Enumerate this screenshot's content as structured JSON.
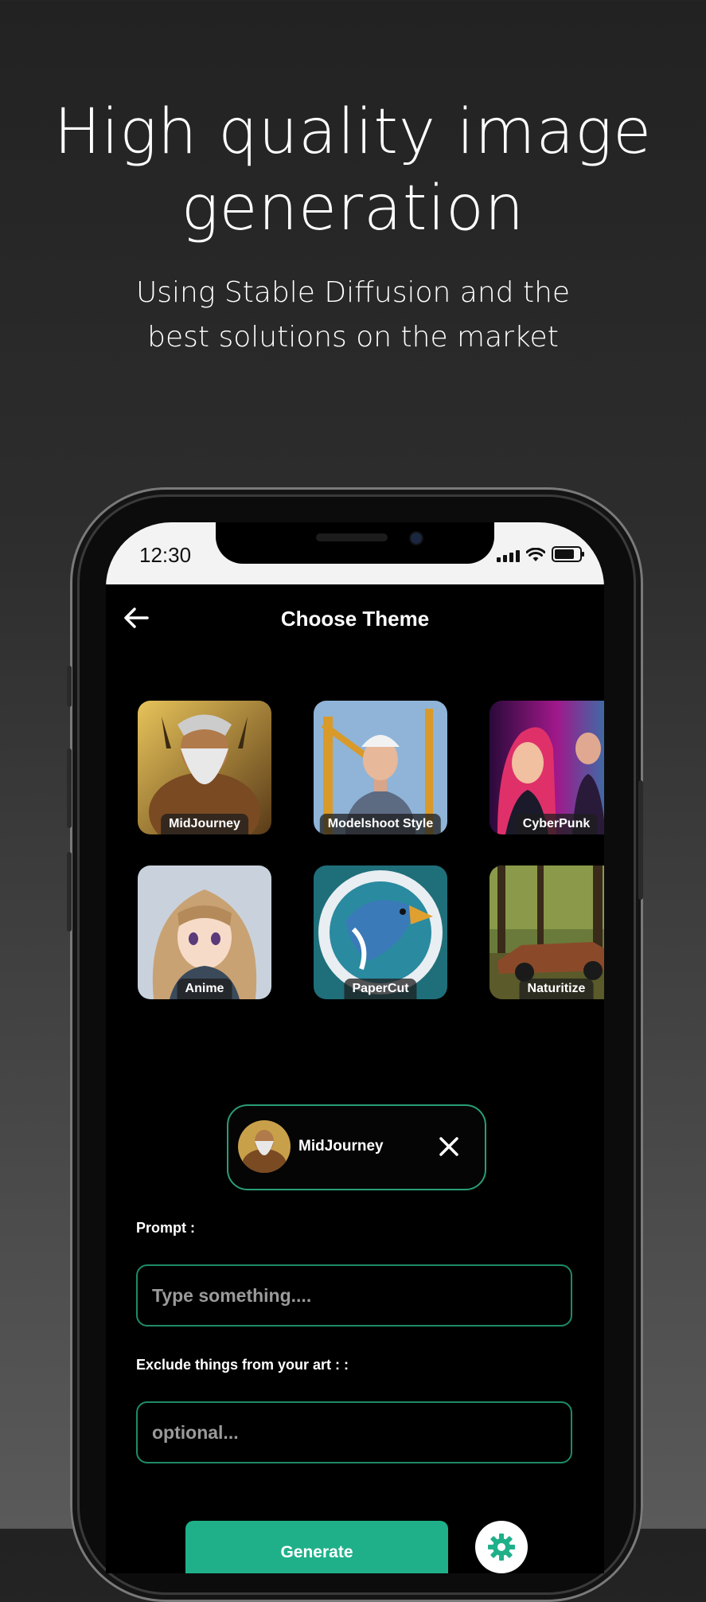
{
  "promo": {
    "title_line1": "High quality image",
    "title_line2": "generation",
    "subtitle_line1": "Using Stable Diffusion and the",
    "subtitle_line2": "best solutions on the market"
  },
  "status_bar": {
    "time": "12:30"
  },
  "header": {
    "title": "Choose Theme"
  },
  "themes": [
    {
      "label": "MidJourney"
    },
    {
      "label": "Modelshoot Style"
    },
    {
      "label": "CyberPunk"
    },
    {
      "label": "Anime"
    },
    {
      "label": "PaperCut"
    },
    {
      "label": "Naturitize"
    }
  ],
  "selected_theme": {
    "label": "MidJourney"
  },
  "prompt": {
    "label": "Prompt :",
    "placeholder": "Type something...."
  },
  "exclude": {
    "label": "Exclude things from your art : :",
    "placeholder": "optional..."
  },
  "actions": {
    "generate_label": "Generate"
  },
  "colors": {
    "accent": "#1fb08a",
    "border_accent": "#1f8a66",
    "background": "#000000"
  }
}
